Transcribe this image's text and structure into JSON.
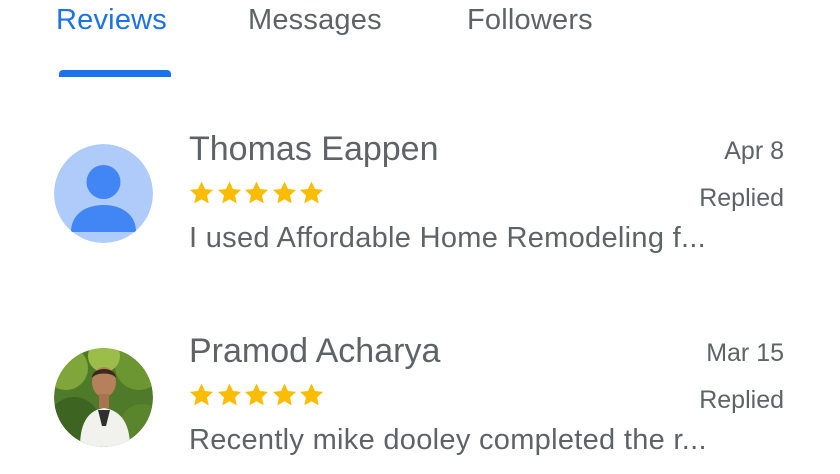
{
  "tabs": [
    {
      "label": "Reviews",
      "active": true
    },
    {
      "label": "Messages",
      "active": false
    },
    {
      "label": "Followers",
      "active": false
    }
  ],
  "colors": {
    "accent": "#1a73e8",
    "text": "#5f6368",
    "star": "#fbbc04",
    "default_avatar_bg": "#aecbfa",
    "default_avatar_fg": "#4285f4"
  },
  "reviews": [
    {
      "name": "Thomas Eappen",
      "date": "Apr 8",
      "rating": 5,
      "status": "Replied",
      "snippet": "I used Affordable Home Remodeling f...",
      "avatar": "default-person-icon"
    },
    {
      "name": "Pramod Acharya",
      "date": "Mar 15",
      "rating": 5,
      "status": "Replied",
      "snippet": "Recently mike dooley completed the r...",
      "avatar": "profile-photo"
    }
  ]
}
